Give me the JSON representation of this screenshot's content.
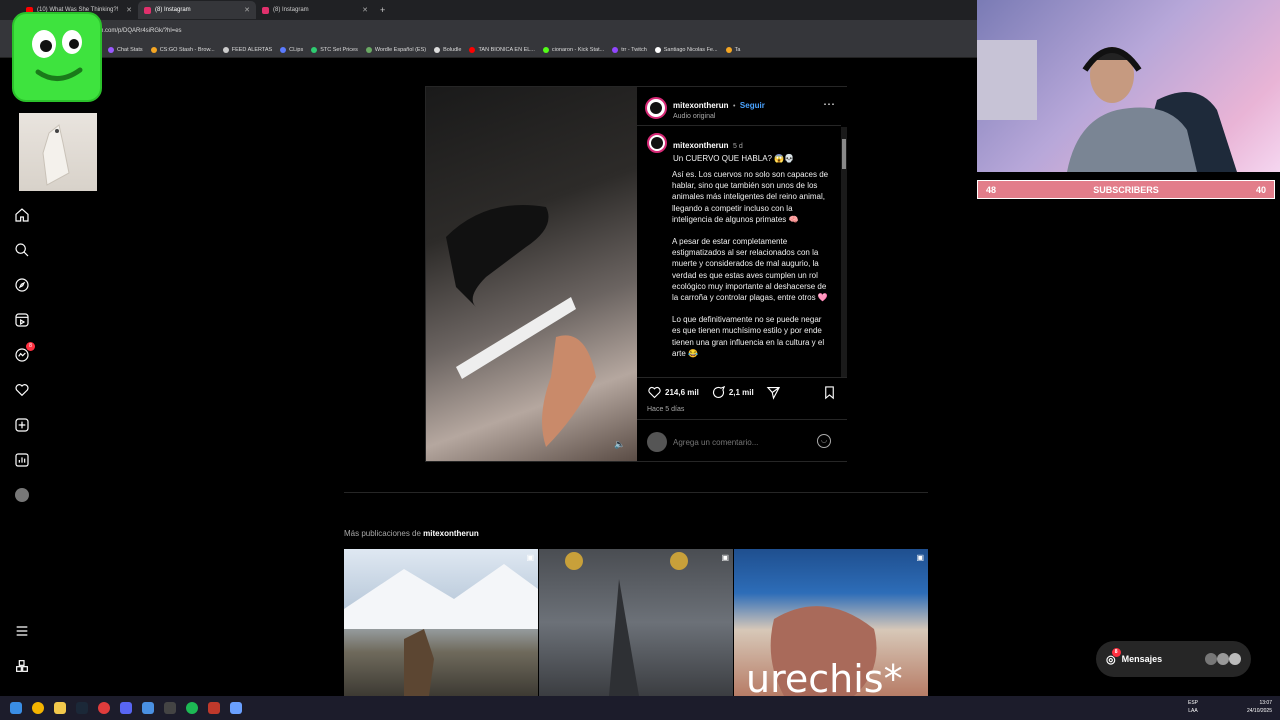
{
  "browser": {
    "tabs": [
      {
        "title": "(10) What Was She Thinking?!",
        "icon": "youtube-icon",
        "color": "#ff0000"
      },
      {
        "title": "(8) Instagram",
        "icon": "instagram-icon",
        "color": "#e1306c"
      },
      {
        "title": "(8) Instagram",
        "icon": "instagram-icon",
        "color": "#e1306c"
      }
    ],
    "url": "am.com/p/DQARr4siRGk/?hl=es",
    "bookmarks": [
      "Chat Stats",
      "CS:GO Stash - Brow...",
      "FEED ALERTAS",
      "CLips",
      "STC Set Prices",
      "Wordle Español (ES)",
      "Boludle",
      "TAN BIONICA EN EL...",
      "cionaron - Kick Stat...",
      "trr - Twitch",
      "Santiago Nicolas Fe...",
      "Ta"
    ]
  },
  "nav": {
    "items": [
      "home-icon",
      "search-icon",
      "explore-icon",
      "reels-icon",
      "messenger-icon",
      "heart-icon",
      "create-icon",
      "dashboard-icon",
      "profile-avatar"
    ],
    "messenger_badge": "8",
    "bottom": [
      "menu-icon",
      "apps-icon"
    ]
  },
  "post": {
    "username": "mitexontherun",
    "follow_label": "Seguir",
    "audio": "Audio original",
    "caption_user": "mitexontherun",
    "caption_time": "5 d",
    "caption_lines": [
      "Un CUERVO QUE HABLA? 😱💀",
      "Así es. Los cuervos no solo son capaces de hablar, sino que también son unos de los animales más inteligentes del reino animal, llegando a competir incluso con la inteligencia de algunos primates 🧠",
      "A pesar de estar completamente estigmatizados al ser relacionados con la muerte y considerados de mal augurio, la verdad es que estas aves cumplen un rol ecológico muy importante al deshacerse de la carroña y controlar plagas, entre otros 🩷",
      "Lo que definitivamente no se puede negar es que tienen muchísimo estilo y por ende tienen una gran influencia en la cultura y el arte 😂"
    ],
    "likes": "214,6 mil",
    "comments": "2,1 mil",
    "posted": "Hace 5 días",
    "comment_placeholder": "Agrega un comentario..."
  },
  "more": {
    "prefix": "Más publicaciones de",
    "user": "mitexontherun",
    "thumb3_text": "urechis*"
  },
  "messages": {
    "label": "Mensajes",
    "badge": "8"
  },
  "stream": {
    "left": "48",
    "label": "SUBSCRIBERS",
    "right": "40"
  },
  "taskbar": {
    "lang1": "ESP",
    "lang2": "LAA",
    "time": "13:07",
    "date": "24/10/2025"
  }
}
